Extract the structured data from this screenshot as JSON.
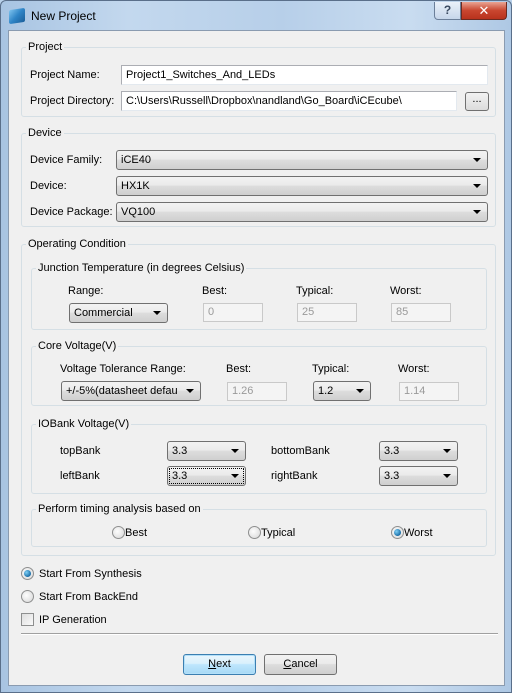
{
  "window": {
    "title": "New Project",
    "help_label": "?",
    "close_label": "✕"
  },
  "project": {
    "group_label": "Project",
    "name_label": "Project Name:",
    "name_value": "Project1_Switches_And_LEDs",
    "directory_label": "Project Directory:",
    "directory_value": "C:\\Users\\Russell\\Dropbox\\nandland\\Go_Board\\iCEcube\\",
    "browse_label": "..."
  },
  "device": {
    "group_label": "Device",
    "family_label": "Device Family:",
    "family_value": "iCE40",
    "device_label": "Device:",
    "device_value": "HX1K",
    "package_label": "Device Package:",
    "package_value": "VQ100"
  },
  "operating_condition": {
    "group_label": "Operating Condition",
    "junction": {
      "group_label": "Junction Temperature (in degrees Celsius)",
      "range_label": "Range:",
      "range_value": "Commercial",
      "best_label": "Best:",
      "best_value": "0",
      "typical_label": "Typical:",
      "typical_value": "25",
      "worst_label": "Worst:",
      "worst_value": "85"
    },
    "core_voltage": {
      "group_label": "Core Voltage(V)",
      "tolerance_label": "Voltage Tolerance Range:",
      "tolerance_value": "+/-5%(datasheet defau",
      "best_label": "Best:",
      "best_value": "1.26",
      "typical_label": "Typical:",
      "typical_value": "1.2",
      "worst_label": "Worst:",
      "worst_value": "1.14"
    },
    "iobank": {
      "group_label": "IOBank Voltage(V)",
      "top_label": "topBank",
      "top_value": "3.3",
      "bottom_label": "bottomBank",
      "bottom_value": "3.3",
      "left_label": "leftBank",
      "left_value": "3.3",
      "right_label": "rightBank",
      "right_value": "3.3"
    },
    "timing": {
      "group_label": "Perform timing analysis based on",
      "options": [
        "Best",
        "Typical",
        "Worst"
      ],
      "selected": "Worst"
    }
  },
  "start": {
    "synthesis_label": "Start From Synthesis",
    "backend_label": "Start From BackEnd",
    "selected": "Start From Synthesis",
    "ip_generation_label": "IP Generation",
    "ip_generation_checked": false
  },
  "buttons": {
    "next_mnemonic": "N",
    "next_rest": "ext",
    "cancel_mnemonic": "C",
    "cancel_rest": "ancel"
  }
}
